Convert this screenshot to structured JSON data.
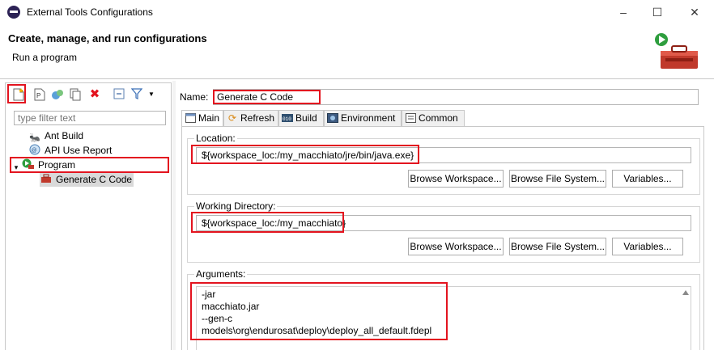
{
  "window": {
    "title": "External Tools Configurations",
    "controls": [
      "–",
      "☐",
      "✕"
    ]
  },
  "header": {
    "title": "Create, manage, and run configurations",
    "subtitle": "Run a program",
    "icon": "toolbox-icon"
  },
  "left": {
    "toolbar_icons": [
      "new-config-icon",
      "new-prototype-icon",
      "export-icon",
      "duplicate-icon",
      "delete-icon",
      "collapse-all-icon",
      "filter-icon",
      "dropdown-icon"
    ],
    "filter_placeholder": "type filter text",
    "tree": [
      {
        "label": "Ant Build",
        "icon": "ant-icon",
        "level": 0
      },
      {
        "label": "API Use Report",
        "icon": "api-report-icon",
        "level": 0
      },
      {
        "label": "Program",
        "icon": "program-icon",
        "level": 0,
        "expanded": true
      },
      {
        "label": "Generate C Code",
        "icon": "program-config-icon",
        "level": 1,
        "selected": true
      }
    ]
  },
  "form": {
    "name_label": "Name:",
    "name_value": "Generate C Code",
    "tabs": [
      "Main",
      "Refresh",
      "Build",
      "Environment",
      "Common"
    ],
    "active_tab": "Main",
    "location_label": "Location:",
    "location_value": "${workspace_loc:/my_macchiato/jre/bin/java.exe}",
    "workdir_label": "Working Directory:",
    "workdir_value": "${workspace_loc:/my_macchiato}",
    "browse_workspace": "Browse Workspace...",
    "browse_filesystem": "Browse File System...",
    "variables": "Variables...",
    "arguments_label": "Arguments:",
    "arguments_lines": [
      "-jar",
      "macchiato.jar",
      "--gen-c",
      "models\\org\\endurosat\\deploy\\deploy_all_default.fdepl"
    ]
  },
  "colors": {
    "highlight": "#e3141f",
    "border": "#c8c8c8"
  }
}
